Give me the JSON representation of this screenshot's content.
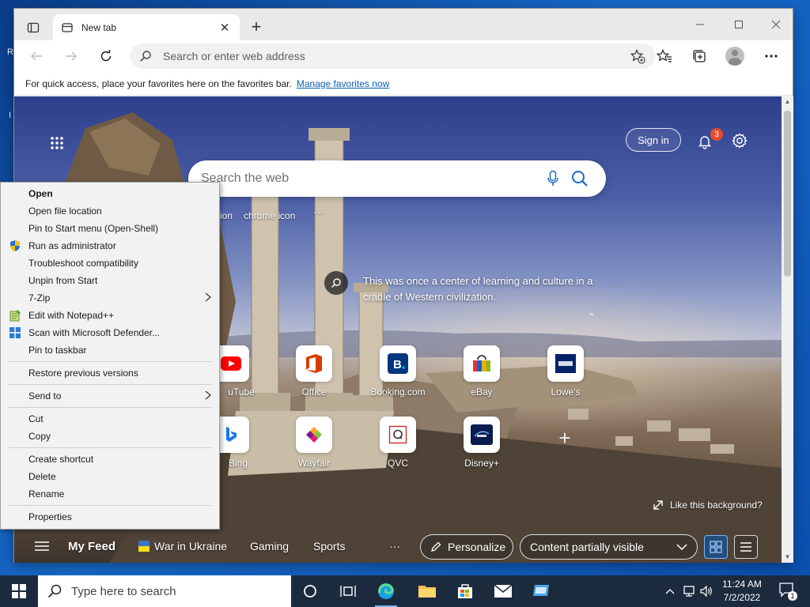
{
  "desktop": {
    "edge_glyph_1": "R",
    "edge_glyph_2": "I"
  },
  "browser": {
    "tab_title": "New tab",
    "address_placeholder": "Search or enter web address",
    "favorites_bar_text": "For quick access, place your favorites here on the favorites bar.",
    "favorites_bar_link": "Manage favorites now"
  },
  "newtab": {
    "sign_in_label": "Sign in",
    "notification_count": "3",
    "search_placeholder": "Search the web",
    "quick_link_1": "ion",
    "quick_link_2": "chrome icon",
    "quick_link_more": "···",
    "background_info": "This was once a center of learning and culture in a cradle of Western civilization.",
    "like_background": "Like this background?",
    "tiles": [
      {
        "label": "YouTube",
        "visible_label": "uTube",
        "icon": "youtube-icon"
      },
      {
        "label": "Office",
        "icon": "office-icon"
      },
      {
        "label": "Booking.com",
        "icon": "booking-icon"
      },
      {
        "label": "eBay",
        "icon": "ebay-icon"
      },
      {
        "label": "Lowe's",
        "icon": "lowes-icon"
      },
      {
        "label": "Bing",
        "icon": "bing-icon"
      },
      {
        "label": "Wayfair",
        "icon": "wayfair-icon"
      },
      {
        "label": "QVC",
        "icon": "qvc-icon"
      },
      {
        "label": "Disney+",
        "icon": "disney-icon"
      }
    ],
    "feed": {
      "my_feed": "My Feed",
      "war_in_ukraine": "War in Ukraine",
      "gaming": "Gaming",
      "sports": "Sports",
      "more": "···",
      "personalize": "Personalize",
      "content_visibility": "Content partially visible"
    }
  },
  "context_menu": {
    "items": [
      "Open",
      "Open file location",
      "Pin to Start menu (Open-Shell)",
      "Run as administrator",
      "Troubleshoot compatibility",
      "Unpin from Start",
      "7-Zip",
      "Edit with Notepad++",
      "Scan with Microsoft Defender...",
      "Pin to taskbar",
      "Restore previous versions",
      "Send to",
      "Cut",
      "Copy",
      "Create shortcut",
      "Delete",
      "Rename",
      "Properties"
    ]
  },
  "taskbar": {
    "search_placeholder": "Type here to search",
    "time": "11:24 AM",
    "date": "7/2/2022",
    "notification_count": "1"
  },
  "colors": {
    "accent": "#0a5fb5",
    "badge": "#e74c2c",
    "taskbar": "#1c2a3e"
  }
}
